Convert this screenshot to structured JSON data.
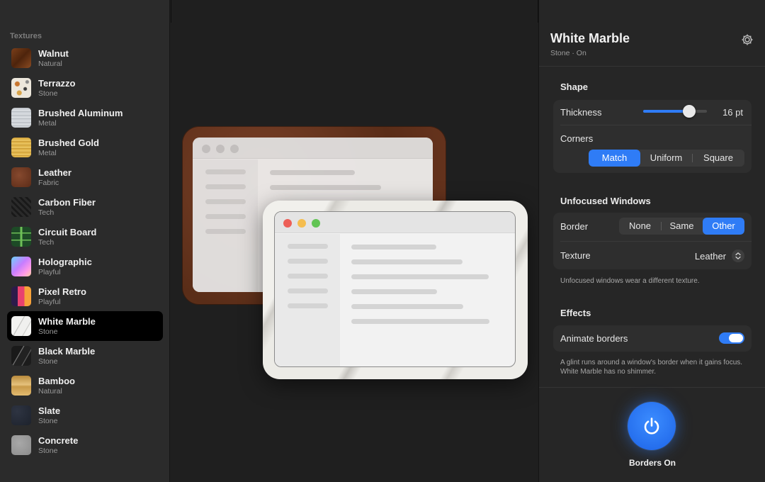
{
  "sidebar": {
    "heading": "Textures",
    "items": [
      {
        "name": "Walnut",
        "category": "Natural",
        "swatch": "t-walnut"
      },
      {
        "name": "Terrazzo",
        "category": "Stone",
        "swatch": "t-terrazzo"
      },
      {
        "name": "Brushed Aluminum",
        "category": "Metal",
        "swatch": "t-alu"
      },
      {
        "name": "Brushed Gold",
        "category": "Metal",
        "swatch": "t-gold"
      },
      {
        "name": "Leather",
        "category": "Fabric",
        "swatch": "t-leather"
      },
      {
        "name": "Carbon Fiber",
        "category": "Tech",
        "swatch": "t-carbon"
      },
      {
        "name": "Circuit Board",
        "category": "Tech",
        "swatch": "t-circuit"
      },
      {
        "name": "Holographic",
        "category": "Playful",
        "swatch": "t-holo"
      },
      {
        "name": "Pixel Retro",
        "category": "Playful",
        "swatch": "t-pixel"
      },
      {
        "name": "White Marble",
        "category": "Stone",
        "swatch": "t-white-marble",
        "selected": true
      },
      {
        "name": "Black Marble",
        "category": "Stone",
        "swatch": "t-black-marble"
      },
      {
        "name": "Bamboo",
        "category": "Natural",
        "swatch": "t-bamboo"
      },
      {
        "name": "Slate",
        "category": "Stone",
        "swatch": "t-slate"
      },
      {
        "name": "Concrete",
        "category": "Stone",
        "swatch": "t-concrete"
      }
    ]
  },
  "inspector": {
    "title": "White Marble",
    "subtitle": "Stone · On",
    "settings_icon": "gear-icon",
    "shape": {
      "title": "Shape",
      "thickness_label": "Thickness",
      "thickness_value": "16 pt",
      "thickness_fraction": 0.72,
      "corners_label": "Corners",
      "corners_options": [
        "Match",
        "Uniform",
        "Square"
      ],
      "corners_selected": "Match"
    },
    "unfocused": {
      "title": "Unfocused Windows",
      "border_label": "Border",
      "border_options": [
        "None",
        "Same",
        "Other"
      ],
      "border_selected": "Other",
      "texture_label": "Texture",
      "texture_value": "Leather",
      "note": "Unfocused windows wear a different texture."
    },
    "effects": {
      "title": "Effects",
      "animate_label": "Animate borders",
      "animate_on": true,
      "note": "A glint runs around a window's border when it gains focus. White Marble has no shimmer."
    },
    "power_label": "Borders On",
    "power_icon": "power-icon"
  },
  "colors": {
    "accent": "#2f7cf6",
    "traffic_red": "#ed5f57",
    "traffic_yellow": "#f5bd4f",
    "traffic_green": "#61c454"
  }
}
